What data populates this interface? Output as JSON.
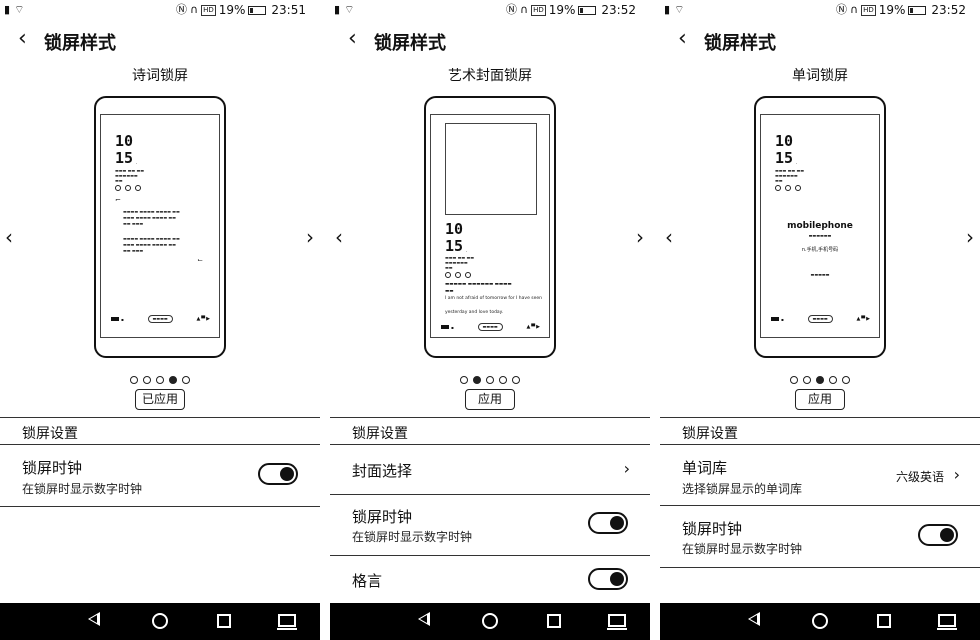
{
  "status": {
    "battery_percent": "19%",
    "hd_badge": "HD"
  },
  "screens": [
    {
      "time": "23:51",
      "title": "锁屏样式",
      "style_name": "诗词锁屏",
      "preview": {
        "hour": "10",
        "minute": "15"
      },
      "pager": {
        "count": 5,
        "active": 3
      },
      "apply_label": "已应用",
      "section_title": "锁屏设置",
      "rows": [
        {
          "title": "锁屏时钟",
          "subtitle": "在锁屏时显示数字时钟",
          "toggle": true
        }
      ]
    },
    {
      "time": "23:52",
      "title": "锁屏样式",
      "style_name": "艺术封面锁屏",
      "preview": {
        "hour": "10",
        "minute": "15",
        "quote_lines": [
          "I am not afraid of tomorrow for I have seen",
          "yesterday and love today."
        ]
      },
      "pager": {
        "count": 5,
        "active": 1
      },
      "apply_label": "应用",
      "section_title": "锁屏设置",
      "rows": [
        {
          "title": "封面选择",
          "chevron": true
        },
        {
          "title": "锁屏时钟",
          "subtitle": "在锁屏时显示数字时钟",
          "toggle": true
        },
        {
          "title": "格言",
          "toggle": true
        }
      ]
    },
    {
      "time": "23:52",
      "title": "锁屏样式",
      "style_name": "单词锁屏",
      "preview": {
        "hour": "10",
        "minute": "15",
        "word": "mobilephone",
        "definition": "n.手机,手机号码"
      },
      "pager": {
        "count": 5,
        "active": 2
      },
      "apply_label": "应用",
      "section_title": "锁屏设置",
      "rows": [
        {
          "title": "单词库",
          "subtitle": "选择锁屏显示的单词库",
          "value": "六级英语",
          "chevron": true
        },
        {
          "title": "锁屏时钟",
          "subtitle": "在锁屏时显示数字时钟",
          "toggle": true
        }
      ]
    }
  ]
}
